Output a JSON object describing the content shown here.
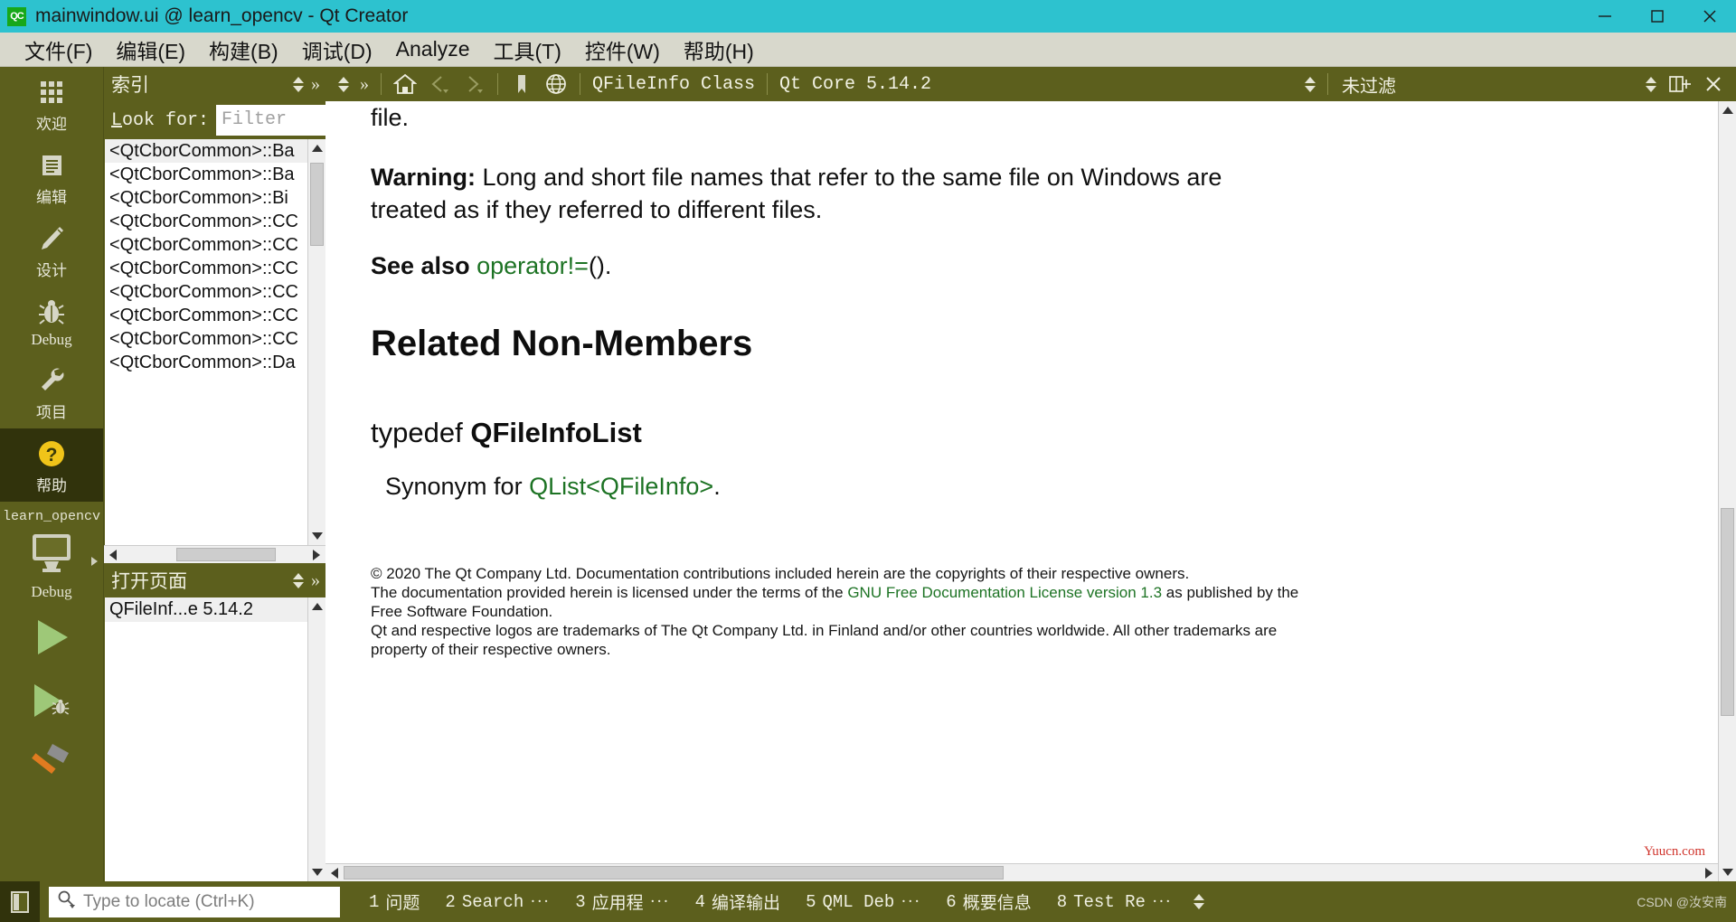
{
  "window": {
    "title": "mainwindow.ui @ learn_opencv - Qt Creator",
    "logo_text": "QC",
    "minimize": "─",
    "maximize": "☐",
    "close": "✕"
  },
  "menubar": {
    "items": [
      {
        "text": "文件(F)",
        "accel": "F"
      },
      {
        "text": "编辑(E)",
        "accel": "E"
      },
      {
        "text": "构建(B)",
        "accel": "B"
      },
      {
        "text": "调试(D)",
        "accel": "D"
      },
      {
        "text": "Analyze",
        "accel": "A"
      },
      {
        "text": "工具(T)",
        "accel": "T"
      },
      {
        "text": "控件(W)",
        "accel": "W"
      },
      {
        "text": "帮助(H)",
        "accel": "H"
      }
    ]
  },
  "modebar": {
    "items": [
      {
        "label": "欢迎",
        "icon": "grid-icon"
      },
      {
        "label": "编辑",
        "icon": "document-icon"
      },
      {
        "label": "设计",
        "icon": "pencil-icon"
      },
      {
        "label": "Debug",
        "icon": "bug-icon"
      },
      {
        "label": "项目",
        "icon": "wrench-icon"
      },
      {
        "label": "帮助",
        "icon": "question-mark-icon"
      }
    ],
    "active_index": 5,
    "kit": {
      "project": "learn_opencv",
      "build_config": "Debug",
      "icon": "monitor-icon"
    },
    "run_buttons": [
      {
        "name": "run-button",
        "icon": "play-icon"
      },
      {
        "name": "debug-button",
        "icon": "play-bug-icon"
      },
      {
        "name": "build-button",
        "icon": "hammer-icon"
      }
    ]
  },
  "index_panel": {
    "title": "索引",
    "lookfor_label": "Look for:",
    "lookfor_accel": "L",
    "filter_placeholder": "Filter",
    "filter_value": "",
    "items": [
      "<QtCborCommon>::Ba",
      "<QtCborCommon>::Ba",
      "<QtCborCommon>::Bi",
      "<QtCborCommon>::CC",
      "<QtCborCommon>::CC",
      "<QtCborCommon>::CC",
      "<QtCborCommon>::CC",
      "<QtCborCommon>::CC",
      "<QtCborCommon>::CC",
      "<QtCborCommon>::Da"
    ],
    "selected_index": 0
  },
  "openpages_panel": {
    "title": "打开页面",
    "items": [
      "QFileInf...e 5.14.2"
    ],
    "selected_index": 0
  },
  "help_toolbar": {
    "home_icon": "home-icon",
    "back_icon": "back-arrow-icon",
    "forward_icon": "forward-arrow-icon",
    "bookmark_icon": "bookmark-icon",
    "globe_icon": "globe-icon",
    "expand_icon": "chevron-double-right-icon",
    "page_title": "QFileInfo Class",
    "doc_set": "Qt Core 5.14.2",
    "filter_label": "未过滤",
    "split_icon": "split-view-icon",
    "close_icon": "close-icon"
  },
  "document": {
    "para_partial": "file.",
    "warning_label": "Warning:",
    "warning_line1": "Long and short file names that refer to the same file on Windows are",
    "warning_line2": "treated as if they referred to different files.",
    "see_also_label": "See also",
    "see_also_link": "operator!=",
    "see_also_tail": "().",
    "heading_related": "Related Non-Members",
    "typedef_kw": "typedef",
    "typedef_name": "QFileInfoList",
    "synonym_prefix": "Synonym for ",
    "synonym_link_1": "QList",
    "synonym_lt": "<",
    "synonym_link_2": "QFileInfo",
    "synonym_gt": ">",
    "synonym_period": ".",
    "footer": {
      "line1": "© 2020 The Qt Company Ltd. Documentation contributions included herein are the copyrights of their respective owners.",
      "line2_pre": "The documentation provided herein is licensed under the terms of the ",
      "line2_link": "GNU Free Documentation License version 1.3",
      "line2_post": " as published by the",
      "line3": "Free Software Foundation.",
      "line4": "Qt and respective logos are trademarks of The Qt Company Ltd. in Finland and/or other countries worldwide. All other trademarks are",
      "line5": "property of their respective owners."
    },
    "watermark": "Yuucn.com"
  },
  "statusbar": {
    "toggle_sidebar_icon": "toggle-sidebar-icon",
    "locator_icon": "search-icon",
    "locator_placeholder": "Type to locate (Ctrl+K)",
    "output_panes": [
      {
        "num": "1",
        "label": "问题",
        "mono": false,
        "ellipsis": false
      },
      {
        "num": "2",
        "label": "Search",
        "mono": true,
        "ellipsis": true
      },
      {
        "num": "3",
        "label": "应用程",
        "mono": false,
        "ellipsis": true
      },
      {
        "num": "4",
        "label": "编译输出",
        "mono": false,
        "ellipsis": false
      },
      {
        "num": "5",
        "label": "QML Deb",
        "mono": true,
        "ellipsis": true
      },
      {
        "num": "6",
        "label": "概要信息",
        "mono": false,
        "ellipsis": false
      },
      {
        "num": "8",
        "label": "Test Re",
        "mono": true,
        "ellipsis": true
      }
    ],
    "credit": "CSDN @汝安南"
  },
  "colors": {
    "titlebar": "#2dc2cf",
    "menubar": "#d8d8cc",
    "olive": "#5c5f1d",
    "olive_dark": "#31330c",
    "link_green": "#1d7324",
    "accent_yellow": "#f0c419"
  }
}
